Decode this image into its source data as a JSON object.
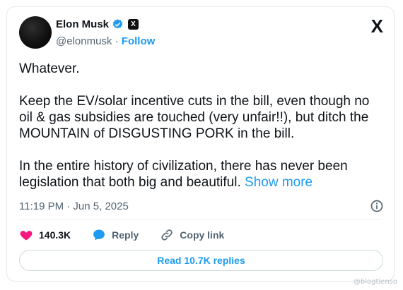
{
  "author": {
    "name": "Elon Musk",
    "handle": "@elonmusk",
    "separator": " · ",
    "follow_label": "Follow"
  },
  "platform_logo": "X",
  "affiliate_badge": "X",
  "tweet": {
    "paragraphs": [
      "Whatever.",
      "Keep the EV/solar incentive cuts in the bill, even though no oil & gas subsidies are touched (very unfair!!), but ditch the MOUNTAIN of DISGUSTING PORK in the bill.",
      "In the entire history of civilization, there has never been legislation that both big and beautiful."
    ],
    "show_more": "Show more",
    "timestamp": "11:19 PM · Jun 5, 2025"
  },
  "actions": {
    "likes": "140.3K",
    "reply_label": "Reply",
    "copy_label": "Copy link"
  },
  "read_replies_label": "Read 10.7K replies",
  "watermark": "@blogtienso",
  "colors": {
    "accent": "#1d9bf0",
    "like_red": "#f91880",
    "text": "#0f1419",
    "muted": "#536471"
  },
  "icons": [
    "verified-badge-icon",
    "x-affiliate-icon",
    "x-logo-icon",
    "info-icon",
    "heart-icon",
    "reply-bubble-icon",
    "link-icon"
  ]
}
